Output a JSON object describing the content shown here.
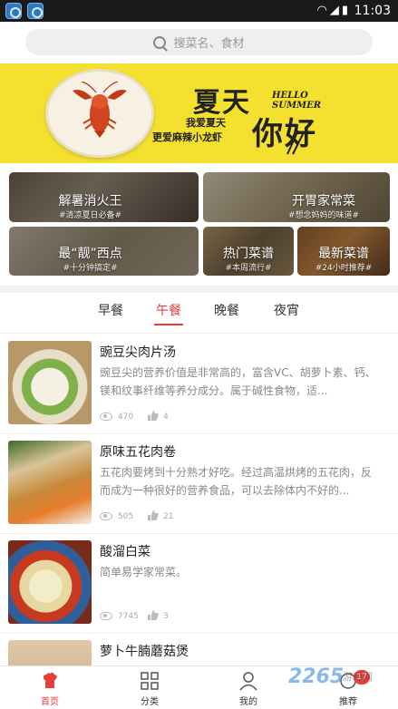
{
  "status_bar": {
    "time": "11:03",
    "icons": [
      "wifi-icon",
      "signal-icon",
      "battery-icon"
    ]
  },
  "search": {
    "placeholder": "搜菜名、食材"
  },
  "banner": {
    "title_line1": "夏天",
    "title_line2": "你好",
    "english": "HELLO\nSUMMER",
    "subtitle1": "我爱夏天",
    "subtitle2": "更爱麻辣小龙虾"
  },
  "categories": [
    {
      "title": "解暑消火王",
      "subtitle": "#清凉夏日必备#"
    },
    {
      "title": "开胃家常菜",
      "subtitle": "#想念妈妈的味道#"
    },
    {
      "title": "最“靓”西点",
      "subtitle": "#十分钟搞定#"
    },
    {
      "title": "热门菜谱",
      "subtitle": "#本周流行#"
    },
    {
      "title": "最新菜谱",
      "subtitle": "#24小时推荐#"
    }
  ],
  "meal_tabs": {
    "items": [
      "早餐",
      "午餐",
      "晚餐",
      "夜宵"
    ],
    "active": "午餐"
  },
  "recipes": [
    {
      "title": "豌豆尖肉片汤",
      "desc": "豌豆尖的营养价值是非常高的，富含VC、胡萝卜素、钙、镁和纹事纤维等养分成分。属于碱性食物，适...",
      "views": "470",
      "likes": "4"
    },
    {
      "title": "原味五花肉卷",
      "desc": "五花肉要烤到十分熟才好吃。经过高温烘烤的五花肉，反而成为一种很好的营养食品，可以去除体内不好的...",
      "views": "505",
      "likes": "21"
    },
    {
      "title": "酸溜白菜",
      "desc": "简单易学家常菜。",
      "views": "7745",
      "likes": "3"
    },
    {
      "title": "萝卜牛腩蘑菇煲",
      "desc": "",
      "views": "",
      "likes": ""
    }
  ],
  "bottom_nav": {
    "items": [
      {
        "label": "首页",
        "icon": "home-chef-icon"
      },
      {
        "label": "分类",
        "icon": "grid-icon"
      },
      {
        "label": "我的",
        "icon": "user-icon"
      },
      {
        "label": "推荐",
        "icon": "recommend-icon"
      }
    ],
    "active": "首页",
    "badge": "17"
  },
  "watermark": {
    "text": "2265",
    "sub": "游戏网"
  },
  "colors": {
    "accent": "#e83d3d",
    "banner_bg": "#f4e12f",
    "status_bar_bg": "#1a1a1a"
  }
}
